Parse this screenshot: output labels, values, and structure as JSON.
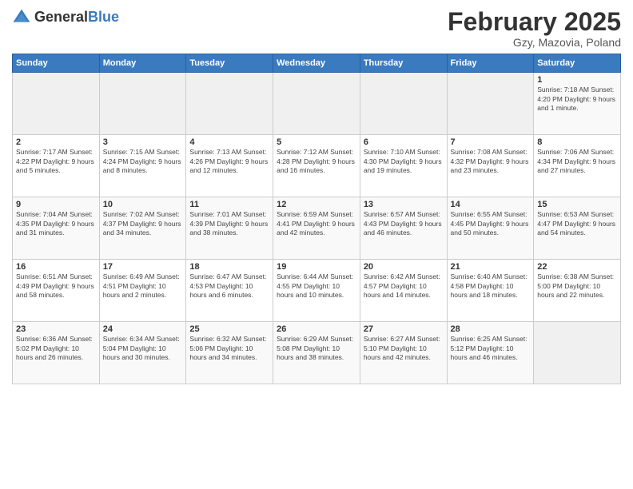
{
  "header": {
    "logo_general": "General",
    "logo_blue": "Blue",
    "month_title": "February 2025",
    "subtitle": "Gzy, Mazovia, Poland"
  },
  "days_of_week": [
    "Sunday",
    "Monday",
    "Tuesday",
    "Wednesday",
    "Thursday",
    "Friday",
    "Saturday"
  ],
  "weeks": [
    [
      {
        "day": "",
        "info": ""
      },
      {
        "day": "",
        "info": ""
      },
      {
        "day": "",
        "info": ""
      },
      {
        "day": "",
        "info": ""
      },
      {
        "day": "",
        "info": ""
      },
      {
        "day": "",
        "info": ""
      },
      {
        "day": "1",
        "info": "Sunrise: 7:18 AM\nSunset: 4:20 PM\nDaylight: 9 hours and 1 minute."
      }
    ],
    [
      {
        "day": "2",
        "info": "Sunrise: 7:17 AM\nSunset: 4:22 PM\nDaylight: 9 hours and 5 minutes."
      },
      {
        "day": "3",
        "info": "Sunrise: 7:15 AM\nSunset: 4:24 PM\nDaylight: 9 hours and 8 minutes."
      },
      {
        "day": "4",
        "info": "Sunrise: 7:13 AM\nSunset: 4:26 PM\nDaylight: 9 hours and 12 minutes."
      },
      {
        "day": "5",
        "info": "Sunrise: 7:12 AM\nSunset: 4:28 PM\nDaylight: 9 hours and 16 minutes."
      },
      {
        "day": "6",
        "info": "Sunrise: 7:10 AM\nSunset: 4:30 PM\nDaylight: 9 hours and 19 minutes."
      },
      {
        "day": "7",
        "info": "Sunrise: 7:08 AM\nSunset: 4:32 PM\nDaylight: 9 hours and 23 minutes."
      },
      {
        "day": "8",
        "info": "Sunrise: 7:06 AM\nSunset: 4:34 PM\nDaylight: 9 hours and 27 minutes."
      }
    ],
    [
      {
        "day": "9",
        "info": "Sunrise: 7:04 AM\nSunset: 4:35 PM\nDaylight: 9 hours and 31 minutes."
      },
      {
        "day": "10",
        "info": "Sunrise: 7:02 AM\nSunset: 4:37 PM\nDaylight: 9 hours and 34 minutes."
      },
      {
        "day": "11",
        "info": "Sunrise: 7:01 AM\nSunset: 4:39 PM\nDaylight: 9 hours and 38 minutes."
      },
      {
        "day": "12",
        "info": "Sunrise: 6:59 AM\nSunset: 4:41 PM\nDaylight: 9 hours and 42 minutes."
      },
      {
        "day": "13",
        "info": "Sunrise: 6:57 AM\nSunset: 4:43 PM\nDaylight: 9 hours and 46 minutes."
      },
      {
        "day": "14",
        "info": "Sunrise: 6:55 AM\nSunset: 4:45 PM\nDaylight: 9 hours and 50 minutes."
      },
      {
        "day": "15",
        "info": "Sunrise: 6:53 AM\nSunset: 4:47 PM\nDaylight: 9 hours and 54 minutes."
      }
    ],
    [
      {
        "day": "16",
        "info": "Sunrise: 6:51 AM\nSunset: 4:49 PM\nDaylight: 9 hours and 58 minutes."
      },
      {
        "day": "17",
        "info": "Sunrise: 6:49 AM\nSunset: 4:51 PM\nDaylight: 10 hours and 2 minutes."
      },
      {
        "day": "18",
        "info": "Sunrise: 6:47 AM\nSunset: 4:53 PM\nDaylight: 10 hours and 6 minutes."
      },
      {
        "day": "19",
        "info": "Sunrise: 6:44 AM\nSunset: 4:55 PM\nDaylight: 10 hours and 10 minutes."
      },
      {
        "day": "20",
        "info": "Sunrise: 6:42 AM\nSunset: 4:57 PM\nDaylight: 10 hours and 14 minutes."
      },
      {
        "day": "21",
        "info": "Sunrise: 6:40 AM\nSunset: 4:58 PM\nDaylight: 10 hours and 18 minutes."
      },
      {
        "day": "22",
        "info": "Sunrise: 6:38 AM\nSunset: 5:00 PM\nDaylight: 10 hours and 22 minutes."
      }
    ],
    [
      {
        "day": "23",
        "info": "Sunrise: 6:36 AM\nSunset: 5:02 PM\nDaylight: 10 hours and 26 minutes."
      },
      {
        "day": "24",
        "info": "Sunrise: 6:34 AM\nSunset: 5:04 PM\nDaylight: 10 hours and 30 minutes."
      },
      {
        "day": "25",
        "info": "Sunrise: 6:32 AM\nSunset: 5:06 PM\nDaylight: 10 hours and 34 minutes."
      },
      {
        "day": "26",
        "info": "Sunrise: 6:29 AM\nSunset: 5:08 PM\nDaylight: 10 hours and 38 minutes."
      },
      {
        "day": "27",
        "info": "Sunrise: 6:27 AM\nSunset: 5:10 PM\nDaylight: 10 hours and 42 minutes."
      },
      {
        "day": "28",
        "info": "Sunrise: 6:25 AM\nSunset: 5:12 PM\nDaylight: 10 hours and 46 minutes."
      },
      {
        "day": "",
        "info": ""
      }
    ]
  ]
}
